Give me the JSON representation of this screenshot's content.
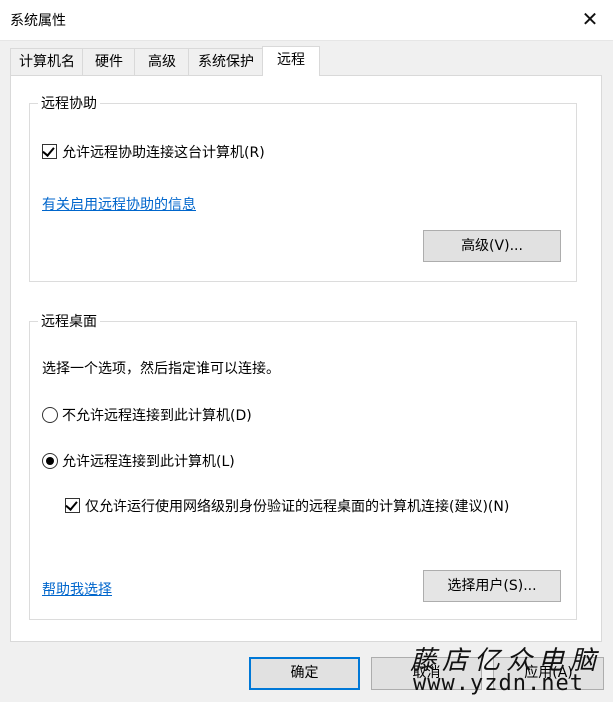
{
  "window": {
    "title": "系统属性"
  },
  "tabs": [
    {
      "label": "计算机名",
      "active": false
    },
    {
      "label": "硬件",
      "active": false
    },
    {
      "label": "高级",
      "active": false
    },
    {
      "label": "系统保护",
      "active": false
    },
    {
      "label": "远程",
      "active": true
    }
  ],
  "remote_assistance": {
    "group_title": "远程协助",
    "allow_checkbox_label": "允许远程协助连接这台计算机(R)",
    "allow_checked": true,
    "info_link": "有关启用远程协助的信息",
    "advanced_button": "高级(V)..."
  },
  "remote_desktop": {
    "group_title": "远程桌面",
    "instruction": "选择一个选项，然后指定谁可以连接。",
    "option_disallow": "不允许远程连接到此计算机(D)",
    "option_allow": "允许远程连接到此计算机(L)",
    "selected_option": "allow",
    "nla_checkbox_label": "仅允许运行使用网络级别身份验证的远程桌面的计算机连接(建议)(N)",
    "nla_checked": true,
    "help_link": "帮助我选择",
    "select_users_button": "选择用户(S)..."
  },
  "footer": {
    "ok_button": "确定",
    "cancel_button": "取消",
    "apply_button": "应用(A)"
  },
  "watermark": {
    "cn_text": "藤店亿众电脑",
    "url_text": "www.yzdn.net"
  }
}
